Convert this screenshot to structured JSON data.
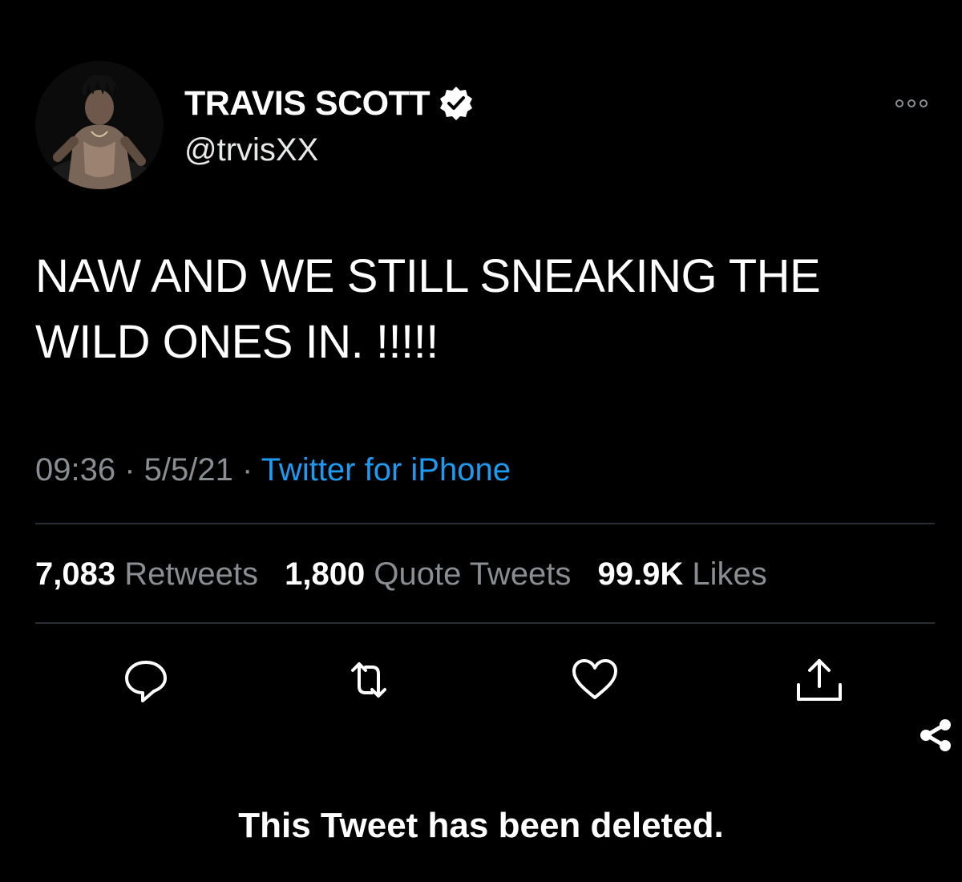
{
  "tweet": {
    "author": {
      "display_name": "TRAVIS SCOTT",
      "handle": "@trvisXX",
      "verified": true,
      "avatar_icon": "avatar-photo"
    },
    "more_icon": "more-dots-icon",
    "text_line1": "NAW AND WE STILL SNEAKING THE",
    "text_line2": "WILD ONES IN. !!!!!",
    "meta": {
      "time": "09:36",
      "separator1": " · ",
      "date": "5/5/21",
      "separator2": " · ",
      "source": "Twitter for iPhone"
    },
    "stats": {
      "retweets_count": "7,083",
      "retweets_label": "Retweets",
      "quotes_count": "1,800",
      "quotes_label": "Quote Tweets",
      "likes_count": "99.9K",
      "likes_label": "Likes"
    },
    "actions": [
      {
        "icon": "reply-icon"
      },
      {
        "icon": "retweet-icon"
      },
      {
        "icon": "like-icon"
      },
      {
        "icon": "share-icon"
      }
    ],
    "corner_icon": "share-nodes-icon"
  },
  "notice": {
    "deleted_text": "This Tweet has been deleted."
  },
  "colors": {
    "background": "#000000",
    "text": "#ffffff",
    "muted": "#8a8d91",
    "link": "#1d9bf0",
    "divider": "#2a2d31"
  }
}
